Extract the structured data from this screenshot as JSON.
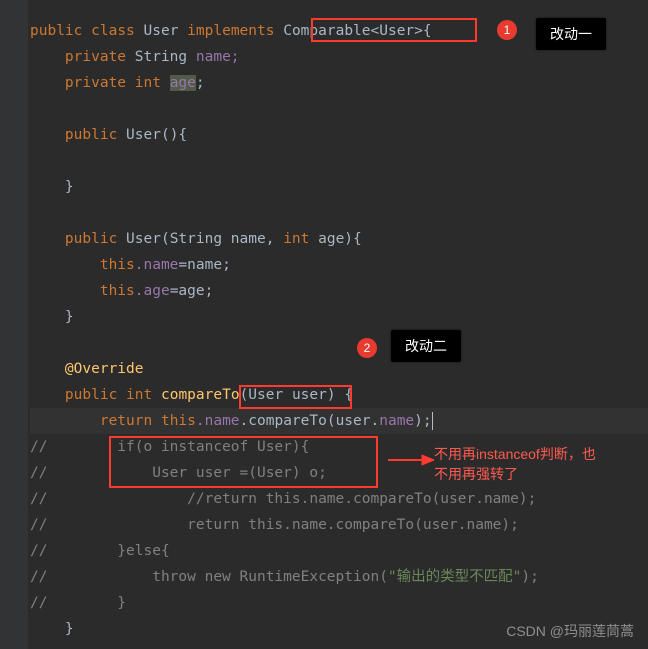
{
  "code": {
    "l1_public": "public",
    "l1_class": "class",
    "l1_name": "User",
    "l1_implements": "implements",
    "l1_iface": "Comparable<User>",
    "l1_open": "{",
    "l2_private": "private",
    "l2_type": "String",
    "l2_name": "name;",
    "l3_private": "private",
    "l3_type": "int",
    "l3_name": "age",
    "l3_semi": ";",
    "l5_public": "public",
    "l5_ctor": "User",
    "l5_paren": "(){",
    "l7_close": "}",
    "l9_public": "public",
    "l9_ctor": "User",
    "l9_params": "(String name, ",
    "l9_int": "int",
    "l9_age": " age){",
    "l10_this": "this",
    "l10_field": ".name",
    "l10_assign": "=name;",
    "l11_this": "this",
    "l11_field": ".age",
    "l11_assign": "=age;",
    "l12_close": "}",
    "l14_override": "@Override",
    "l15_public": "public",
    "l15_int": "int",
    "l15_fn": "compareTo",
    "l15_paren": "(User user)",
    "l15_brace": " {",
    "l16_return": "return",
    "l16_this": " this",
    "l16_field": ".name",
    "l16_call": ".compareTo(user.",
    "l16_field2": "name",
    "l16_end": ");",
    "l17": "//        if(o instanceof User){",
    "l18": "//            User user =(User) o;",
    "l19": "//                //return this.name.compareTo(user.name);",
    "l20": "//                return this.name.compareTo(user.name);",
    "l21": "//        }else{",
    "l22_pre": "//            throw new RuntimeException(",
    "l22_str": "\"输出的类型不匹配\"",
    "l22_post": ");",
    "l23": "//        }",
    "l24": "}"
  },
  "annotations": {
    "badge1": "1",
    "badge2": "2",
    "btn1": "改动一",
    "btn2": "改动二",
    "note1": "不用再instanceof判断，也",
    "note2": "不用再强转了"
  },
  "watermark": "CSDN @玛丽莲茼蒿"
}
